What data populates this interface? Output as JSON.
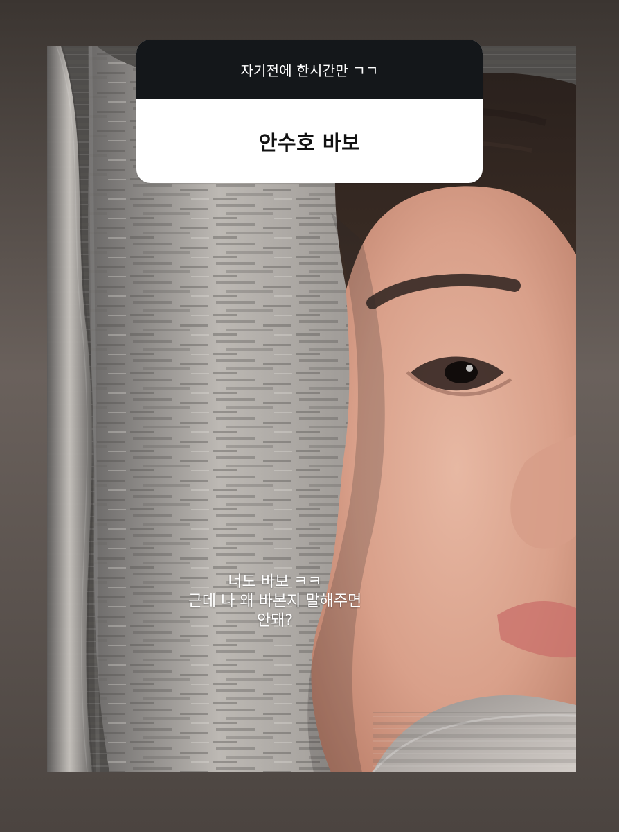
{
  "question_card": {
    "header": "자기전에 한시간만 ㄱㄱ",
    "answer": "안수호 바보"
  },
  "reply": {
    "lines": [
      "너도 바보 ㅋㅋ",
      "근데 나 왜 바본지 말해주면",
      "안돼?"
    ]
  },
  "colors": {
    "header_bg": "#14171a",
    "card_bg": "#ffffff",
    "text_on_photo": "#ffffff"
  }
}
